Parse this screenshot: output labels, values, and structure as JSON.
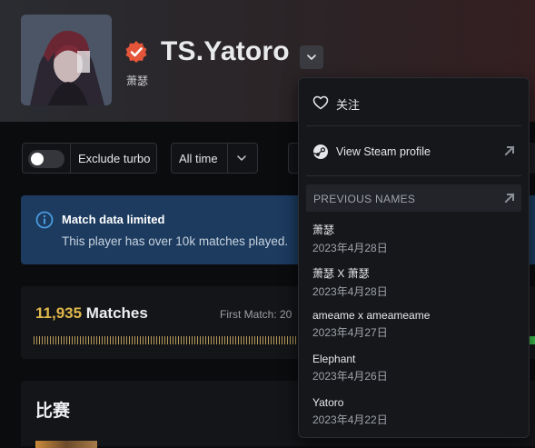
{
  "profile": {
    "name": "TS.Yatoro",
    "alias": "萧瑟"
  },
  "filters": {
    "exclude_turbo_label": "Exclude turbo",
    "time_range_label": "All time"
  },
  "banner": {
    "title": "Match data limited",
    "text": "This player has over 10k matches played."
  },
  "matches": {
    "count": "11,935",
    "label": "Matches",
    "first_match_label": "First Match: 20"
  },
  "section": {
    "title": "比赛"
  },
  "menu": {
    "follow_label": "关注",
    "steam_label": "View Steam profile",
    "previous_names_label": "PREVIOUS NAMES",
    "previous_names": [
      {
        "name": "萧瑟",
        "date": "2023年4月28日"
      },
      {
        "name": "萧瑟 X 萧瑟",
        "date": "2023年4月28日"
      },
      {
        "name": "ameame x ameameame",
        "date": "2023年4月27日"
      },
      {
        "name": "Elephant",
        "date": "2023年4月26日"
      },
      {
        "name": "Yatoro",
        "date": "2023年4月22日"
      }
    ]
  },
  "colors": {
    "verified": "#e4553a",
    "banner_bg": "#1c3b5f",
    "info_icon": "#4a9be0",
    "matches_count": "#e0b84a",
    "progress_green": "#3bbf4a"
  },
  "icons": {
    "verified": "verified-badge-icon",
    "dropdown": "chevron-down-icon",
    "info": "info-circle-icon",
    "follow": "heart-icon",
    "steam": "steam-icon",
    "external": "external-link-icon"
  }
}
